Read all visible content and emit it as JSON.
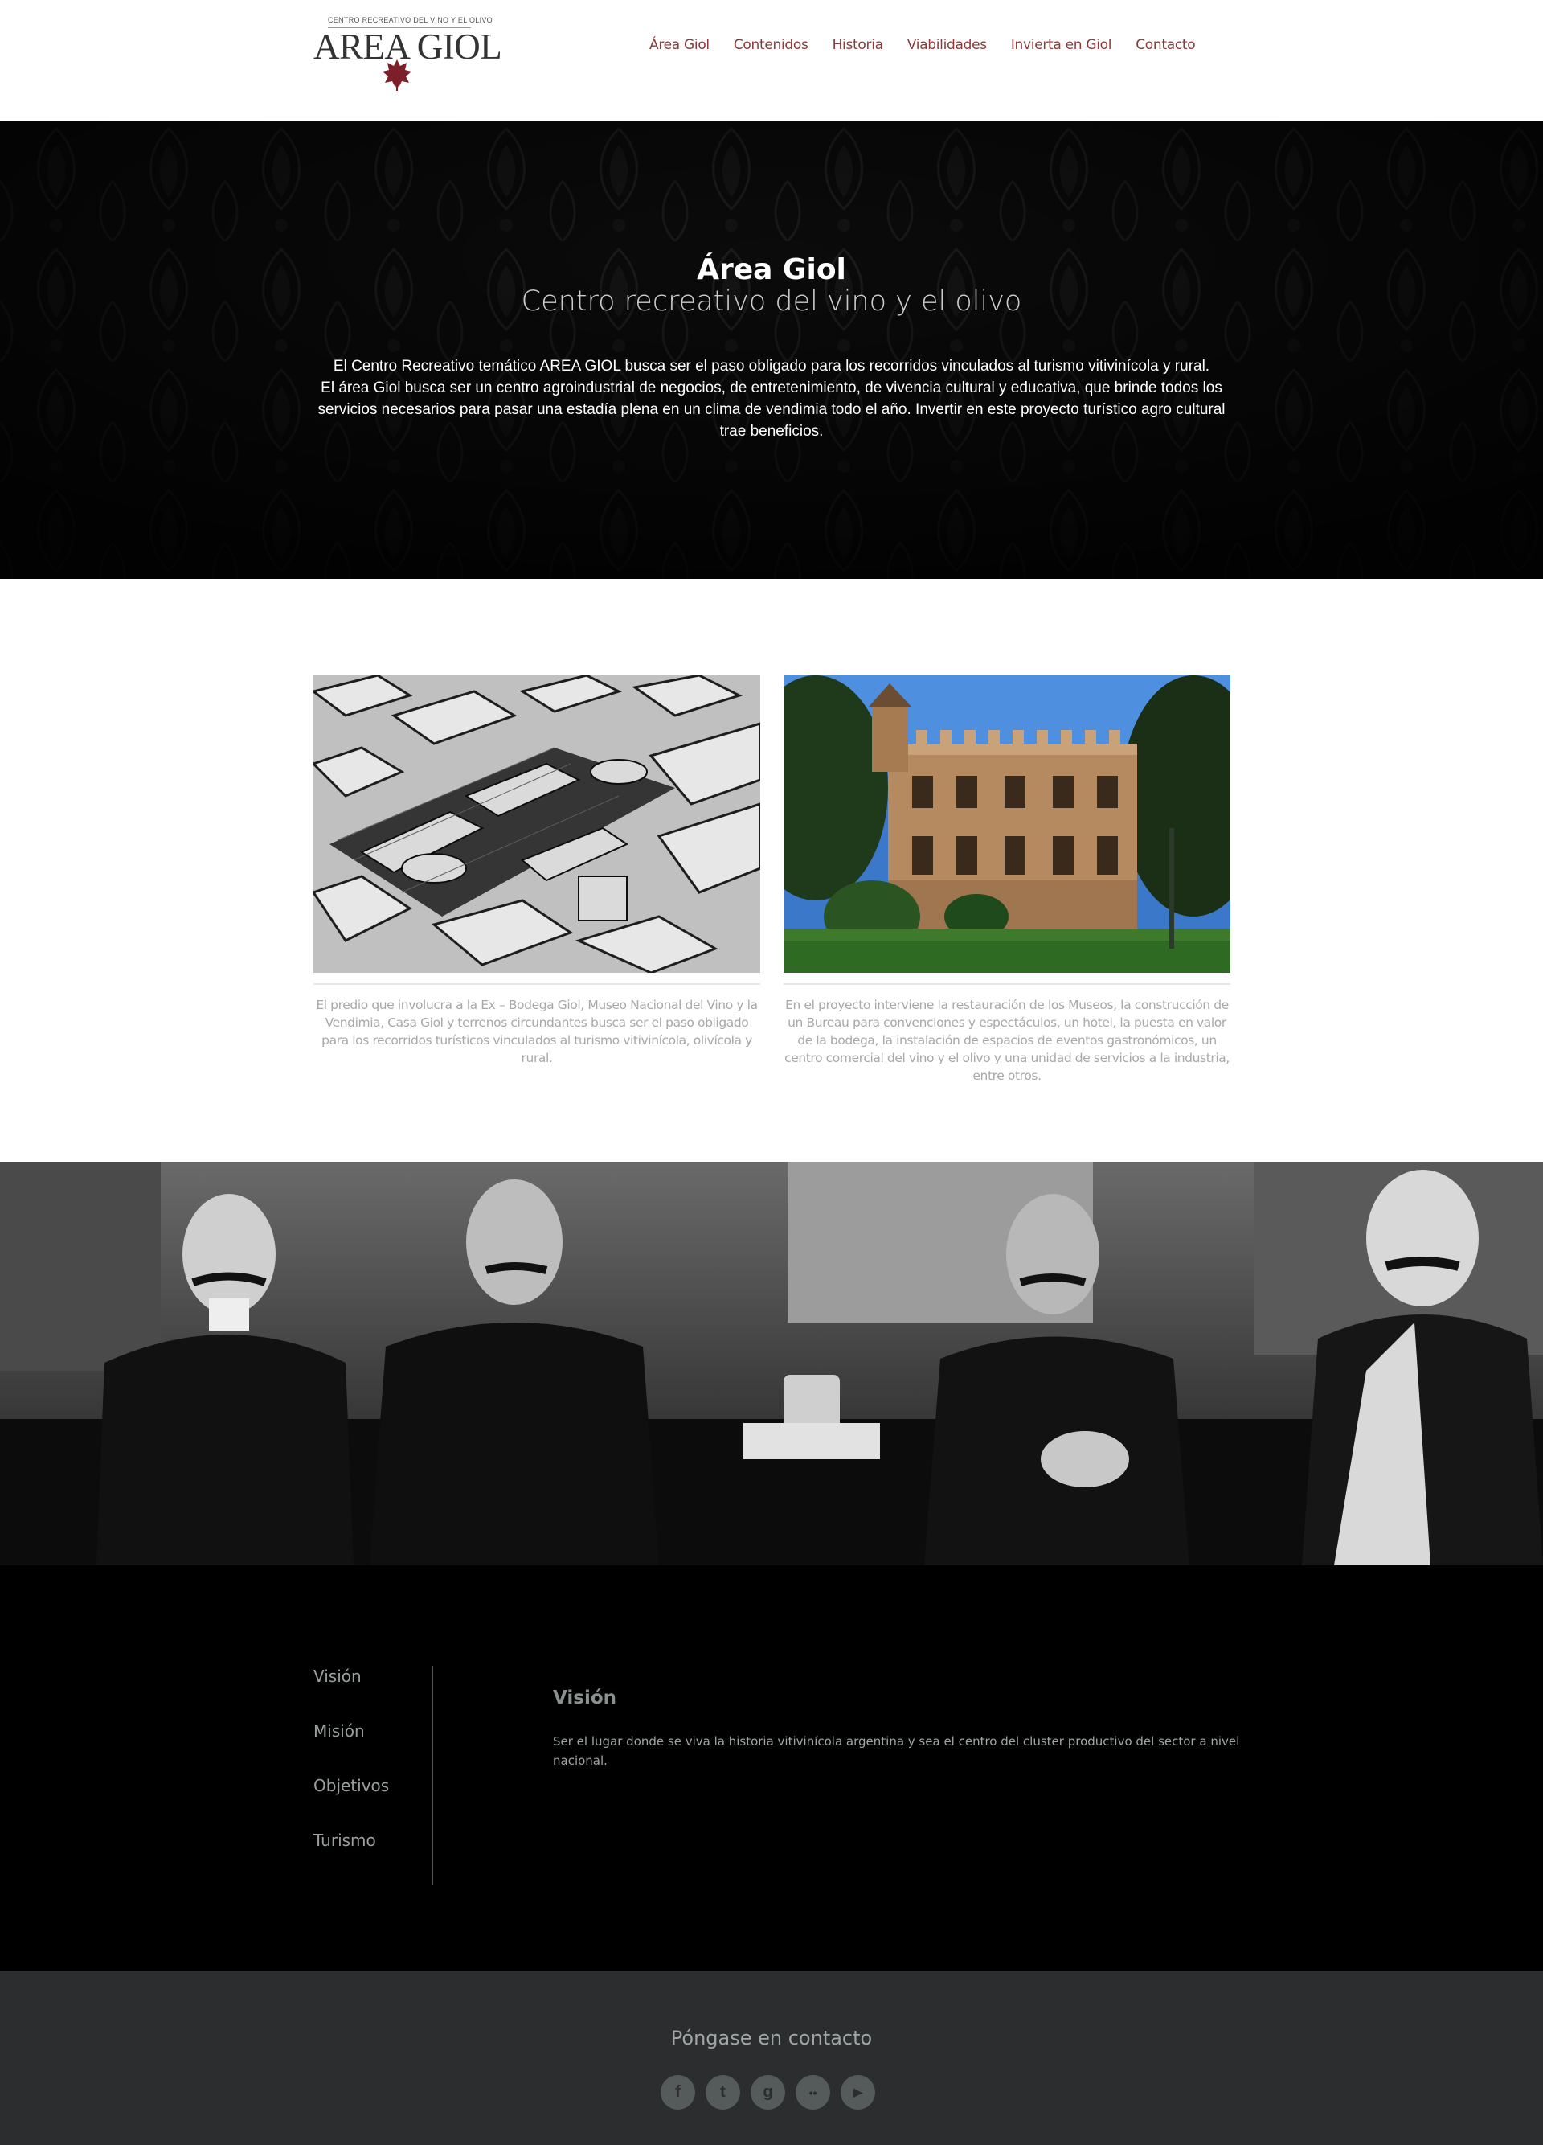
{
  "header": {
    "logo_tagline": "CENTRO RECREATIVO DEL VINO Y EL OLIVO",
    "logo_name": "AREA GIOL",
    "nav": [
      "Área Giol",
      "Contenidos",
      "Historia",
      "Viabilidades",
      "Invierta en Giol",
      "Contacto"
    ]
  },
  "hero": {
    "title": "Área Giol",
    "subtitle": "Centro recreativo del vino y el olivo",
    "text_1": "El Centro Recreativo temático AREA GIOL busca ser el paso obligado para los recorridos vinculados al turismo vitivinícola y rural.",
    "text_2": "El área Giol busca ser un centro agroindustrial de negocios, de entretenimiento, de vivencia cultural y educativa, que brinde todos los servicios necesarios para pasar una estadía plena en un clima de vendimia todo el año. Invertir en este proyecto turístico agro cultural trae beneficios."
  },
  "cards": [
    {
      "text": "El predio que involucra a la Ex – Bodega Giol, Museo Nacional del Vino y la Vendimia, Casa Giol y terrenos circundantes busca ser el paso obligado para los recorridos turísticos vinculados al turismo vitivinícola, olivícola y rural."
    },
    {
      "text": "En el proyecto interviene la restauración de los Museos, la construcción de un Bureau para convenciones y espectáculos, un hotel, la puesta en valor de la bodega, la instalación de espacios de eventos gastronómicos, un centro comercial del vino y el olivo y una unidad de servicios a la industria, entre otros."
    }
  ],
  "vision": {
    "tabs": [
      "Visión",
      "Misión",
      "Objetivos",
      "Turismo"
    ],
    "active_title": "Visión",
    "active_body": "Ser el lugar donde se viva la historia vitivinícola argentina y sea el centro del cluster productivo del sector a nivel nacional."
  },
  "footer": {
    "title": "Póngase en contacto",
    "socials": [
      {
        "icon": "facebook-icon",
        "glyph": "f"
      },
      {
        "icon": "tumblr-icon",
        "glyph": "t"
      },
      {
        "icon": "google-plus-icon",
        "glyph": "g"
      },
      {
        "icon": "flickr-icon",
        "glyph": "••"
      },
      {
        "icon": "youtube-icon",
        "glyph": "▶"
      }
    ]
  },
  "colors": {
    "accent": "#8a3a3a",
    "hero_bg": "#070707",
    "footer_bg": "#2b2d2e"
  }
}
